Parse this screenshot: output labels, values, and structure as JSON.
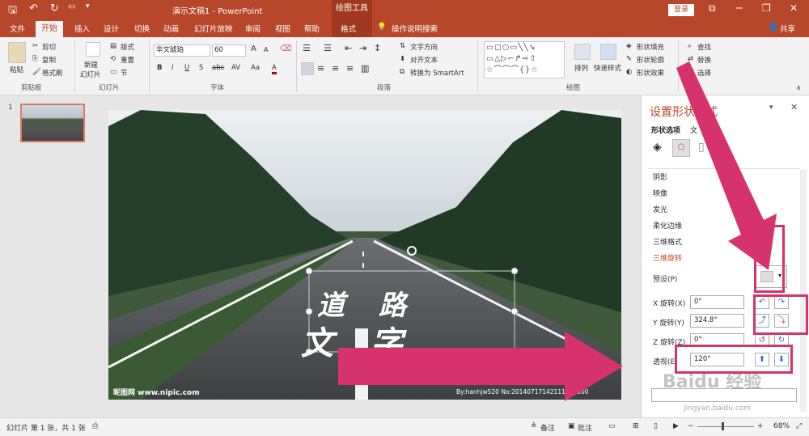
{
  "titlebar": {
    "doc_title": "演示文稿1 - PowerPoint",
    "tool_context": "绘图工具",
    "login": "登录"
  },
  "tabs": {
    "file": "文件",
    "home": "开始",
    "insert": "插入",
    "design": "设计",
    "transitions": "切换",
    "animations": "动画",
    "slideshow": "幻灯片放映",
    "review": "审阅",
    "view": "视图",
    "help": "帮助",
    "format": "格式",
    "search": "操作说明搜索",
    "share": "共享"
  },
  "ribbon": {
    "clipboard": {
      "paste": "粘贴",
      "cut": "剪切",
      "copy": "复制",
      "format_painter": "格式刷",
      "label": "剪贴板"
    },
    "slides": {
      "new_slide_1": "新建",
      "new_slide_2": "幻灯片",
      "layout": "版式",
      "reset": "重置",
      "section": "节",
      "label": "幻灯片"
    },
    "font": {
      "name": "华文琥珀",
      "size": "60",
      "label": "字体",
      "bold": "B",
      "italic": "I",
      "underline": "U",
      "shadow": "S",
      "strike": "abc",
      "spacing": "AV",
      "case": "Aa",
      "grow": "A",
      "shrink": "A",
      "color": "A"
    },
    "paragraph": {
      "text_direction": "文字方向",
      "align_text": "对齐文本",
      "smartart": "转换为 SmartArt",
      "label": "段落"
    },
    "drawing": {
      "arrange": "排列",
      "quick_styles": "快速样式",
      "fill": "形状填充",
      "outline": "形状轮廓",
      "effects": "形状效果",
      "label": "绘图"
    },
    "editing": {
      "find": "查找",
      "replace": "替换",
      "select": "选择"
    }
  },
  "sidebar": {
    "slide_number": "1"
  },
  "slide": {
    "char1": "道",
    "char2": "路",
    "char3": "文",
    "char4": "字",
    "watermark_left": "昵图网 www.nipic.com",
    "watermark_right": "By:hanhjw520 No:20140717142111687000"
  },
  "pane": {
    "title": "设置形状格式",
    "tab_shape": "形状选项",
    "tab_text": "文",
    "options": [
      "阴影",
      "映像",
      "发光",
      "柔化边缘",
      "三维格式",
      "三维旋转"
    ],
    "preset_label": "预设(P)",
    "x_label": "X 旋转(X)",
    "x_value": "0°",
    "y_label": "Y 旋转(Y)",
    "y_value": "324.8°",
    "z_label": "Z 旋转(Z)",
    "z_value": "0°",
    "persp_label": "透视(E)",
    "persp_value": "120°",
    "overlay": "Baidu 经验",
    "overlay_url": "jingyan.baidu.com",
    "accent": "#d6336c"
  },
  "statusbar": {
    "slide_info": "幻灯片 第 1 张，共 1 张",
    "notes": "备注",
    "comments": "批注",
    "zoom": "68%"
  }
}
